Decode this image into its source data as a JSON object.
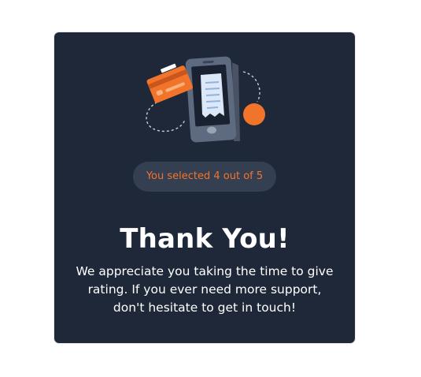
{
  "selection_badge": "You selected 4 out of 5",
  "title": "Thank You!",
  "message": "We appreciate you taking the time to give rating. If you ever need more support, don't hesitate to get in touch!",
  "colors": {
    "card_background": "#1f2839",
    "accent": "#f2742a",
    "badge_background": "#353f52",
    "text": "#ffffff"
  },
  "illustration_icon": "phone-payment-receipt-illustration"
}
